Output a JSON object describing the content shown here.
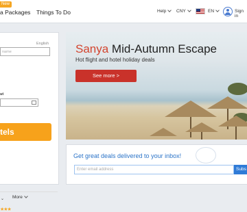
{
  "header": {
    "new_badge": "New",
    "nav": [
      "a Packages",
      "Things To Do"
    ],
    "help": "Help",
    "currency": "CNY",
    "language": "EN",
    "sign_in": "Sign in"
  },
  "left_panel": {
    "language_label": "English",
    "name_placeholder": "name",
    "date_label": "ut",
    "search_button": "tels",
    "more_label": "More",
    "stars": "★★★"
  },
  "hero": {
    "title_accent": "Sanya",
    "title_rest": " Mid-Autumn Escape",
    "subtitle": "Hot flight and hotel holiday deals",
    "button": "See more >"
  },
  "deals": {
    "title": "Get great deals delivered to your inbox!",
    "email_placeholder": "Enter email address",
    "subscribe": "Subs"
  },
  "colors": {
    "accent_orange": "#f7a21b",
    "brand_blue": "#2a73c8",
    "hero_red": "#c9322a"
  }
}
